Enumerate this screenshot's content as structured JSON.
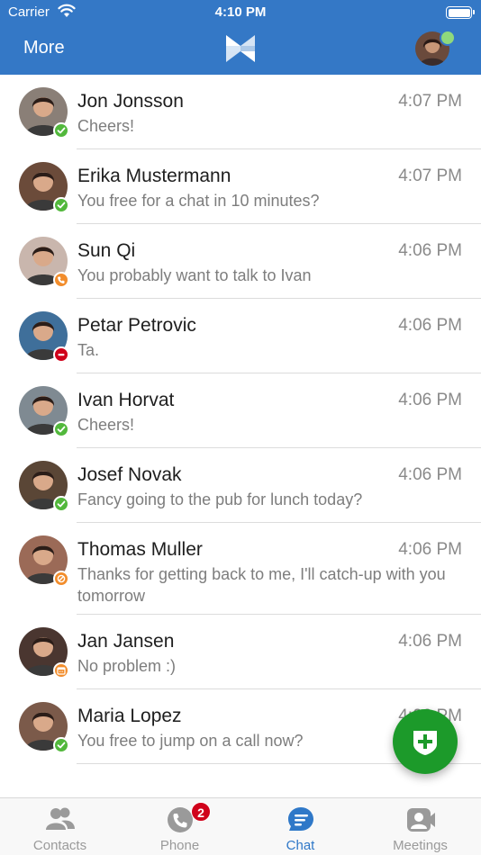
{
  "status_bar": {
    "carrier": "Carrier",
    "time": "4:10 PM"
  },
  "nav": {
    "more_label": "More"
  },
  "chats": [
    {
      "name": "Jon Jonsson",
      "time": "4:07 PM",
      "message": "Cheers!",
      "presence": "online",
      "avatar_color": "#8a7f77"
    },
    {
      "name": "Erika Mustermann",
      "time": "4:07 PM",
      "message": "You free for a chat in 10 minutes?",
      "presence": "online",
      "avatar_color": "#6b4b3a"
    },
    {
      "name": "Sun Qi",
      "time": "4:06 PM",
      "message": "You probably want to talk to Ivan",
      "presence": "phone",
      "avatar_color": "#c9b6ad"
    },
    {
      "name": "Petar Petrovic",
      "time": "4:06 PM",
      "message": "Ta.",
      "presence": "dnd",
      "avatar_color": "#3f6f9a"
    },
    {
      "name": "Ivan Horvat",
      "time": "4:06 PM",
      "message": "Cheers!",
      "presence": "online",
      "avatar_color": "#7f8a92"
    },
    {
      "name": "Josef Novak",
      "time": "4:06 PM",
      "message": "Fancy going to the pub for lunch today?",
      "presence": "online",
      "avatar_color": "#5a4636"
    },
    {
      "name": "Thomas Muller",
      "time": "4:06 PM",
      "message": "Thanks for getting back to me, I'll catch-up with you tomorrow",
      "presence": "away",
      "avatar_color": "#9b6a57"
    },
    {
      "name": "Jan Jansen",
      "time": "4:06 PM",
      "message": "No problem :)",
      "presence": "meeting",
      "avatar_color": "#4a3630"
    },
    {
      "name": "Maria Lopez",
      "time": "4:06 PM",
      "message": "You free to jump on a call now?",
      "presence": "online",
      "avatar_color": "#7b5a4a"
    }
  ],
  "tabs": [
    {
      "label": "Contacts",
      "icon": "contacts-icon",
      "active": false
    },
    {
      "label": "Phone",
      "icon": "phone-icon",
      "active": false,
      "badge": "2"
    },
    {
      "label": "Chat",
      "icon": "chat-icon",
      "active": true
    },
    {
      "label": "Meetings",
      "icon": "meetings-icon",
      "active": false
    }
  ],
  "colors": {
    "brand": "#3478c6",
    "fab": "#1c9a2a",
    "online": "#52b83c",
    "dnd": "#d0021b",
    "away": "#f28d2c",
    "tab_active": "#2f78c8",
    "tab_inactive": "#9a9a9a"
  }
}
